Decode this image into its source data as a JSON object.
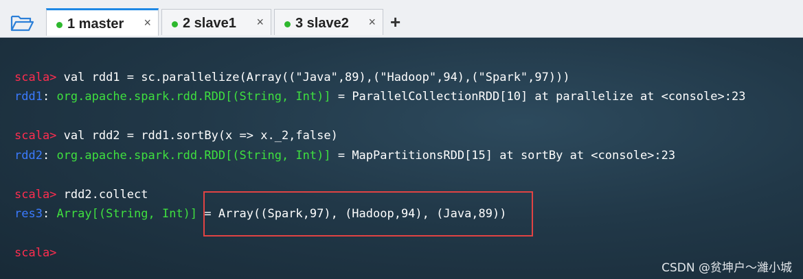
{
  "tabs": [
    {
      "label": "1 master",
      "close": "×"
    },
    {
      "label": "2 slave1",
      "close": "×"
    },
    {
      "label": "3 slave2",
      "close": "×"
    }
  ],
  "new_tab": "+",
  "terminal": {
    "prompt": "scala>",
    "l1": {
      "cmd": " val rdd1 = sc.parallelize(Array((\"Java\",89),(\"Hadoop\",94),(\"Spark\",97)))"
    },
    "l2": {
      "name": "rdd1",
      "colon": ": ",
      "type": "org.apache.spark.rdd.RDD[(String, Int)]",
      "rest": " = ParallelCollectionRDD[10] at parallelize at <console>:23"
    },
    "l3": {
      "cmd": " val rdd2 = rdd1.sortBy(x => x._2,false)"
    },
    "l4": {
      "name": "rdd2",
      "colon": ": ",
      "type": "org.apache.spark.rdd.RDD[(String, Int)]",
      "rest": " = MapPartitionsRDD[15] at sortBy at <console>:23"
    },
    "l5": {
      "cmd": " rdd2.collect"
    },
    "l6": {
      "name": "res3",
      "colon": ": ",
      "type": "Array[(String, Int)]",
      "rest": " = Array((Spark,97), (Hadoop,94), (Java,89))"
    }
  },
  "watermark": "CSDN @贫坤户～濰小城",
  "colors": {
    "prompt": "#ff2d4f",
    "var": "#3b7bff",
    "type": "#3fe03f",
    "highlight_box": "#e24343",
    "active_tab": "#1e88e5"
  }
}
